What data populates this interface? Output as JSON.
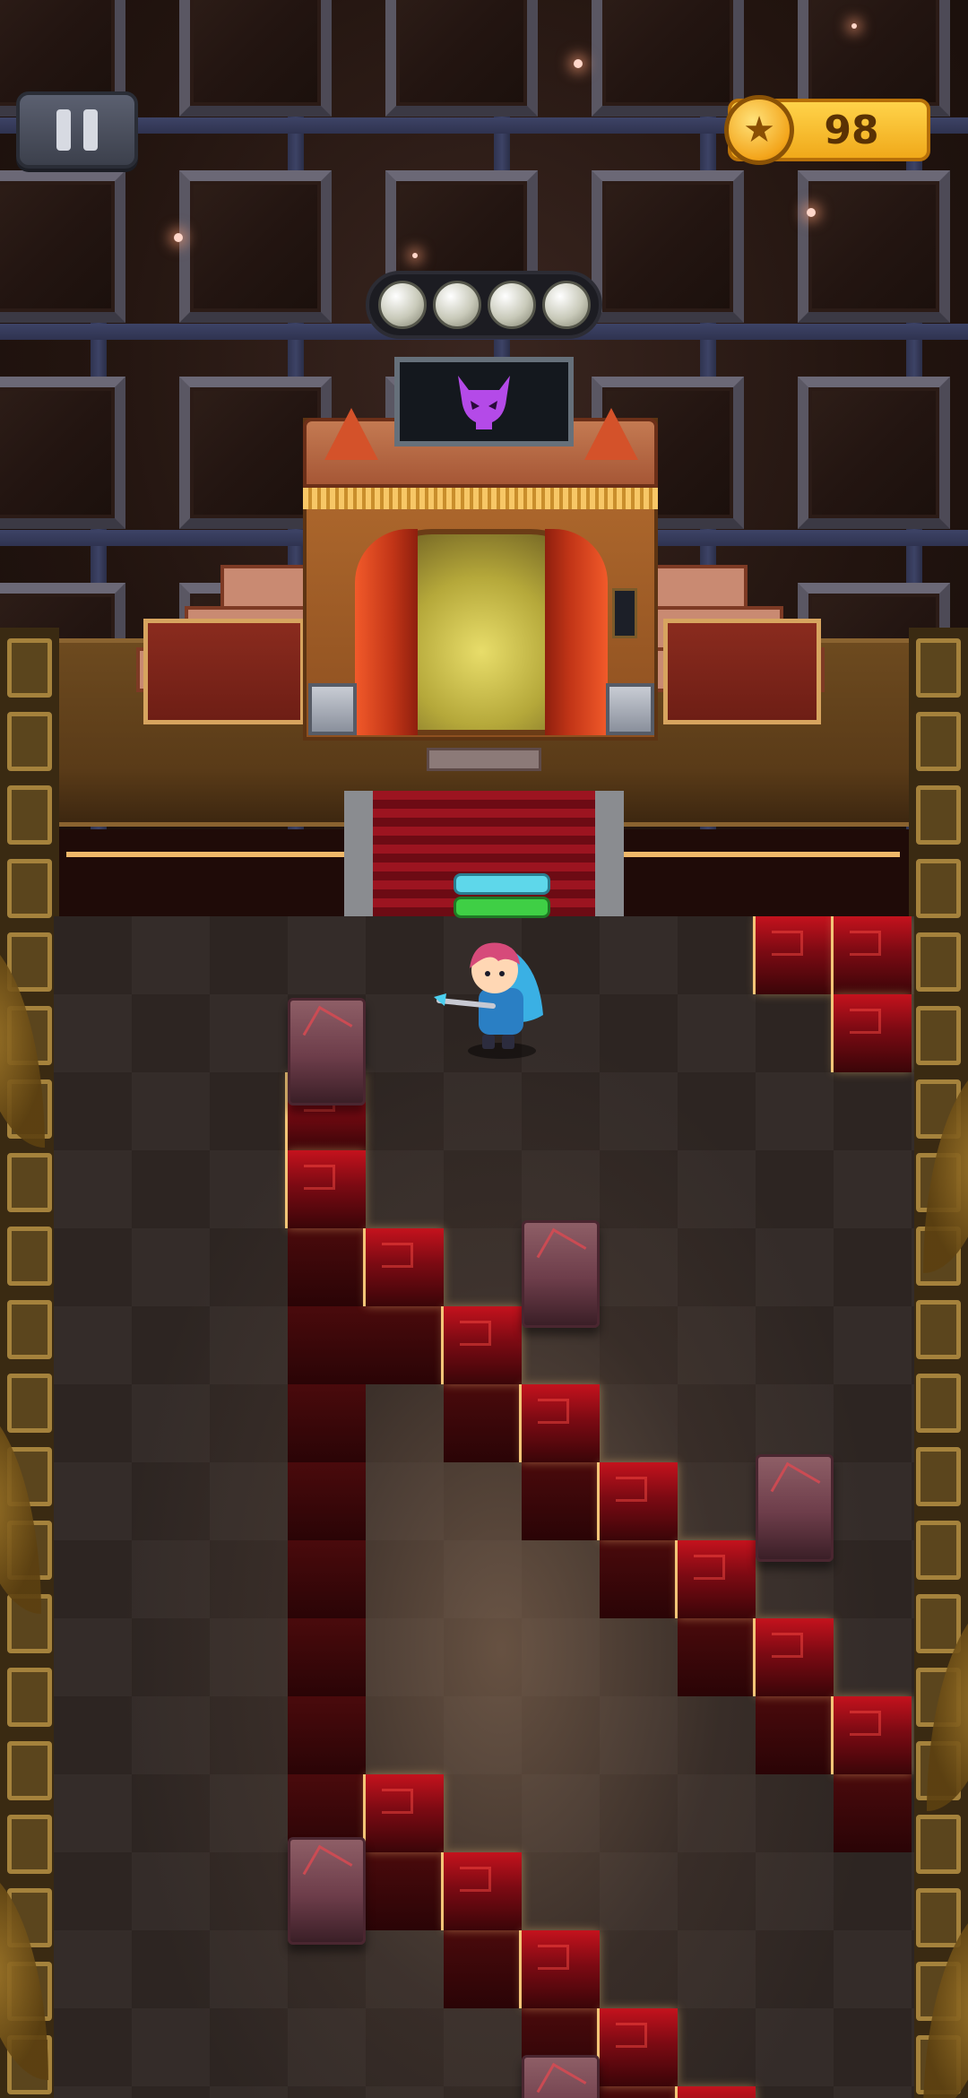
{
  "hud": {
    "pause_icon": "pause-icon",
    "coin_icon": "star-coin-icon",
    "coins": "98"
  },
  "progress": {
    "orbs_total": 4,
    "orbs_collected": 4
  },
  "portal": {
    "boss_icon": "demon-skull-icon",
    "accent": "#b44ae8"
  },
  "hero": {
    "energy_top_color": "#5ed7ea",
    "energy_bottom_color": "#3fcf45"
  },
  "colors": {
    "lava": "#c4121d",
    "lava_glow": "#f3c577",
    "rock": "#8e5e66",
    "coin": "#ffd34a"
  }
}
